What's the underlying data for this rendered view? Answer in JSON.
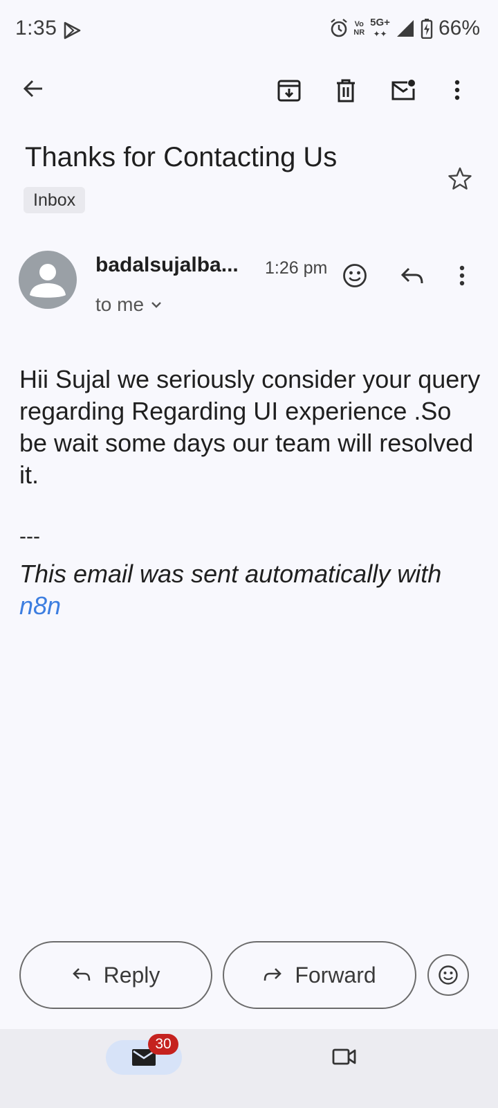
{
  "status_bar": {
    "time": "1:35",
    "volte_top": "Vo",
    "volte_bottom": "NR",
    "network": "5G+",
    "battery": "66%"
  },
  "toolbar": {
    "icons": [
      "back-arrow-icon",
      "archive-icon",
      "delete-icon",
      "mark-unread-icon",
      "more-vert-icon"
    ]
  },
  "email": {
    "subject": "Thanks for Contacting Us",
    "label": "Inbox",
    "sender": "badalsujalba...",
    "time": "1:26 pm",
    "recipient": "to me",
    "body": "Hii Sujal we seriously consider your query regarding Regarding UI experience .So be wait some days our team will resolved it.",
    "signature_separator": "---",
    "signature_text": "This email was sent automatically with ",
    "signature_link": "n8n"
  },
  "actions": {
    "reply_label": "Reply",
    "forward_label": "Forward"
  },
  "bottom_nav": {
    "mail_badge": "30"
  },
  "colors": {
    "background": "#f8f8fd",
    "link": "#3d7ee0",
    "badge": "#c5221f",
    "mail_pill": "#d7e3f8",
    "avatar": "#9aa0a6"
  }
}
